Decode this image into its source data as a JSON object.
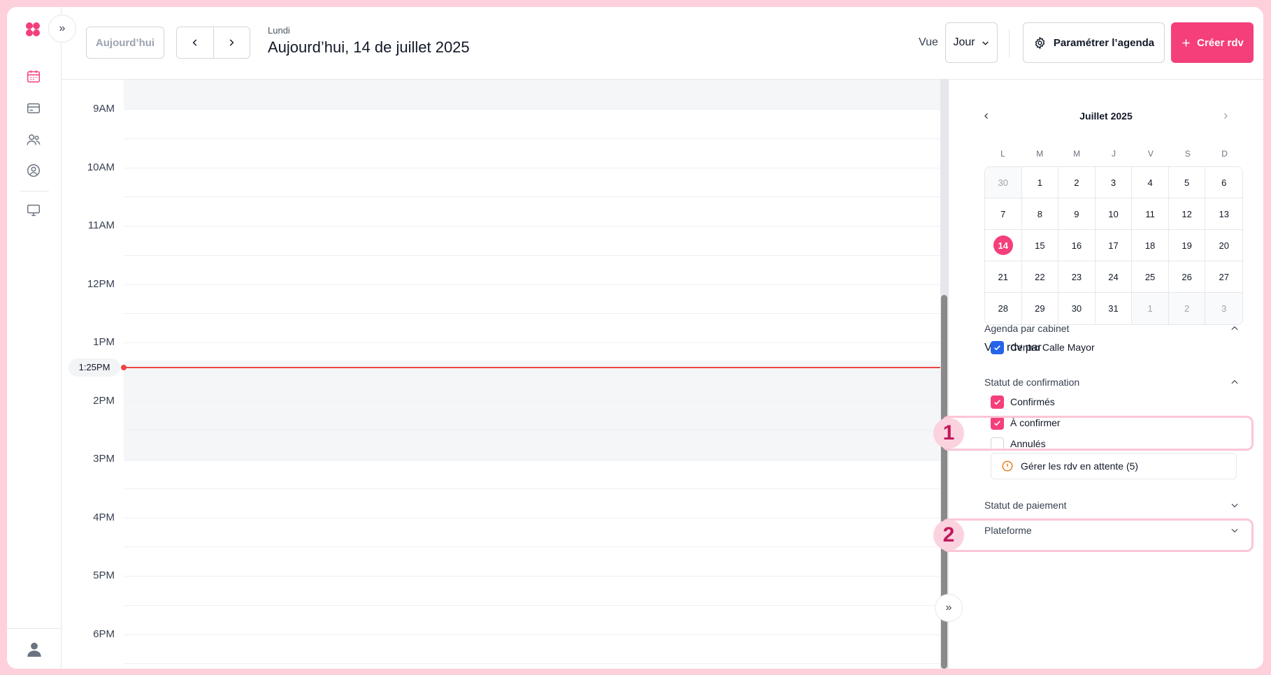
{
  "rail": {
    "icons": [
      "calendar-icon",
      "card-icon",
      "users-icon",
      "user-circle-icon",
      "monitor-icon"
    ],
    "bottom_icon": "profile-icon"
  },
  "header": {
    "today_button": "Aujourd’hui",
    "day_name": "Lundi",
    "date_title": "Aujourd’hui, 14 de juillet 2025",
    "view_label": "Vue",
    "view_value": "Jour",
    "settings_button": "Paramétrer l’agenda",
    "create_button": "Créer rdv"
  },
  "grid": {
    "hours": [
      "9AM",
      "10AM",
      "11AM",
      "12PM",
      "1PM",
      "2PM",
      "3PM",
      "4PM",
      "5PM",
      "6PM"
    ],
    "current_time": "1:25PM"
  },
  "mini_calendar": {
    "title": "Juillet 2025",
    "weekdays": [
      "L",
      "M",
      "M",
      "J",
      "V",
      "S",
      "D"
    ],
    "days": [
      {
        "d": "30",
        "muted": true
      },
      {
        "d": "1"
      },
      {
        "d": "2"
      },
      {
        "d": "3"
      },
      {
        "d": "4"
      },
      {
        "d": "5"
      },
      {
        "d": "6"
      },
      {
        "d": "7"
      },
      {
        "d": "8"
      },
      {
        "d": "9"
      },
      {
        "d": "10"
      },
      {
        "d": "11"
      },
      {
        "d": "12"
      },
      {
        "d": "13"
      },
      {
        "d": "14",
        "today": true
      },
      {
        "d": "15"
      },
      {
        "d": "16"
      },
      {
        "d": "17"
      },
      {
        "d": "18"
      },
      {
        "d": "19"
      },
      {
        "d": "20"
      },
      {
        "d": "21"
      },
      {
        "d": "22"
      },
      {
        "d": "23"
      },
      {
        "d": "24"
      },
      {
        "d": "25"
      },
      {
        "d": "26"
      },
      {
        "d": "27"
      },
      {
        "d": "28"
      },
      {
        "d": "29"
      },
      {
        "d": "30"
      },
      {
        "d": "31"
      },
      {
        "d": "1",
        "muted": true
      },
      {
        "d": "2",
        "muted": true
      },
      {
        "d": "3",
        "muted": true
      }
    ]
  },
  "filters": {
    "title": "Voir rdv par",
    "cabinet": {
      "label": "Agenda par cabinet",
      "option": "Centro Calle Mayor"
    },
    "confirmation": {
      "label": "Statut de confirmation",
      "options": [
        {
          "label": "Confirmés",
          "checked": true
        },
        {
          "label": "À confirmer",
          "checked": true
        },
        {
          "label": "Annulés",
          "checked": false
        }
      ]
    },
    "pending_button": "Gérer les rdv en attente (5)",
    "payment": {
      "label": "Statut de paiement"
    },
    "platform": {
      "label": "Plateforme"
    }
  },
  "annotations": {
    "badge_1": "1",
    "badge_2": "2"
  },
  "colors": {
    "accent": "#f43f7a",
    "checkbox_blue": "#2563eb",
    "now_line": "#ef4444",
    "highlight": "#fbc6d6"
  }
}
